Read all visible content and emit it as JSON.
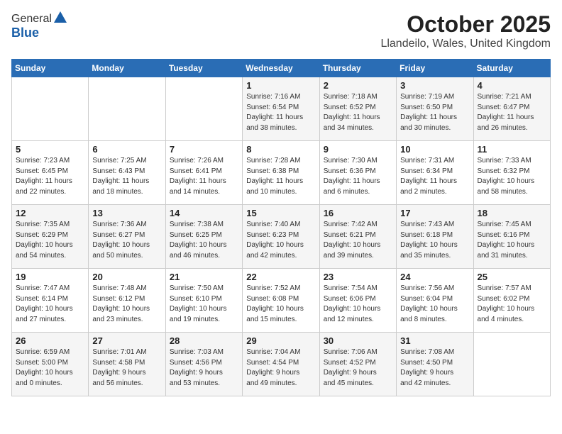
{
  "header": {
    "logo_general": "General",
    "logo_blue": "Blue",
    "month": "October 2025",
    "location": "Llandeilo, Wales, United Kingdom"
  },
  "days_of_week": [
    "Sunday",
    "Monday",
    "Tuesday",
    "Wednesday",
    "Thursday",
    "Friday",
    "Saturday"
  ],
  "weeks": [
    [
      {
        "day": "",
        "content": ""
      },
      {
        "day": "",
        "content": ""
      },
      {
        "day": "",
        "content": ""
      },
      {
        "day": "1",
        "content": "Sunrise: 7:16 AM\nSunset: 6:54 PM\nDaylight: 11 hours\nand 38 minutes."
      },
      {
        "day": "2",
        "content": "Sunrise: 7:18 AM\nSunset: 6:52 PM\nDaylight: 11 hours\nand 34 minutes."
      },
      {
        "day": "3",
        "content": "Sunrise: 7:19 AM\nSunset: 6:50 PM\nDaylight: 11 hours\nand 30 minutes."
      },
      {
        "day": "4",
        "content": "Sunrise: 7:21 AM\nSunset: 6:47 PM\nDaylight: 11 hours\nand 26 minutes."
      }
    ],
    [
      {
        "day": "5",
        "content": "Sunrise: 7:23 AM\nSunset: 6:45 PM\nDaylight: 11 hours\nand 22 minutes."
      },
      {
        "day": "6",
        "content": "Sunrise: 7:25 AM\nSunset: 6:43 PM\nDaylight: 11 hours\nand 18 minutes."
      },
      {
        "day": "7",
        "content": "Sunrise: 7:26 AM\nSunset: 6:41 PM\nDaylight: 11 hours\nand 14 minutes."
      },
      {
        "day": "8",
        "content": "Sunrise: 7:28 AM\nSunset: 6:38 PM\nDaylight: 11 hours\nand 10 minutes."
      },
      {
        "day": "9",
        "content": "Sunrise: 7:30 AM\nSunset: 6:36 PM\nDaylight: 11 hours\nand 6 minutes."
      },
      {
        "day": "10",
        "content": "Sunrise: 7:31 AM\nSunset: 6:34 PM\nDaylight: 11 hours\nand 2 minutes."
      },
      {
        "day": "11",
        "content": "Sunrise: 7:33 AM\nSunset: 6:32 PM\nDaylight: 10 hours\nand 58 minutes."
      }
    ],
    [
      {
        "day": "12",
        "content": "Sunrise: 7:35 AM\nSunset: 6:29 PM\nDaylight: 10 hours\nand 54 minutes."
      },
      {
        "day": "13",
        "content": "Sunrise: 7:36 AM\nSunset: 6:27 PM\nDaylight: 10 hours\nand 50 minutes."
      },
      {
        "day": "14",
        "content": "Sunrise: 7:38 AM\nSunset: 6:25 PM\nDaylight: 10 hours\nand 46 minutes."
      },
      {
        "day": "15",
        "content": "Sunrise: 7:40 AM\nSunset: 6:23 PM\nDaylight: 10 hours\nand 42 minutes."
      },
      {
        "day": "16",
        "content": "Sunrise: 7:42 AM\nSunset: 6:21 PM\nDaylight: 10 hours\nand 39 minutes."
      },
      {
        "day": "17",
        "content": "Sunrise: 7:43 AM\nSunset: 6:18 PM\nDaylight: 10 hours\nand 35 minutes."
      },
      {
        "day": "18",
        "content": "Sunrise: 7:45 AM\nSunset: 6:16 PM\nDaylight: 10 hours\nand 31 minutes."
      }
    ],
    [
      {
        "day": "19",
        "content": "Sunrise: 7:47 AM\nSunset: 6:14 PM\nDaylight: 10 hours\nand 27 minutes."
      },
      {
        "day": "20",
        "content": "Sunrise: 7:48 AM\nSunset: 6:12 PM\nDaylight: 10 hours\nand 23 minutes."
      },
      {
        "day": "21",
        "content": "Sunrise: 7:50 AM\nSunset: 6:10 PM\nDaylight: 10 hours\nand 19 minutes."
      },
      {
        "day": "22",
        "content": "Sunrise: 7:52 AM\nSunset: 6:08 PM\nDaylight: 10 hours\nand 15 minutes."
      },
      {
        "day": "23",
        "content": "Sunrise: 7:54 AM\nSunset: 6:06 PM\nDaylight: 10 hours\nand 12 minutes."
      },
      {
        "day": "24",
        "content": "Sunrise: 7:56 AM\nSunset: 6:04 PM\nDaylight: 10 hours\nand 8 minutes."
      },
      {
        "day": "25",
        "content": "Sunrise: 7:57 AM\nSunset: 6:02 PM\nDaylight: 10 hours\nand 4 minutes."
      }
    ],
    [
      {
        "day": "26",
        "content": "Sunrise: 6:59 AM\nSunset: 5:00 PM\nDaylight: 10 hours\nand 0 minutes."
      },
      {
        "day": "27",
        "content": "Sunrise: 7:01 AM\nSunset: 4:58 PM\nDaylight: 9 hours\nand 56 minutes."
      },
      {
        "day": "28",
        "content": "Sunrise: 7:03 AM\nSunset: 4:56 PM\nDaylight: 9 hours\nand 53 minutes."
      },
      {
        "day": "29",
        "content": "Sunrise: 7:04 AM\nSunset: 4:54 PM\nDaylight: 9 hours\nand 49 minutes."
      },
      {
        "day": "30",
        "content": "Sunrise: 7:06 AM\nSunset: 4:52 PM\nDaylight: 9 hours\nand 45 minutes."
      },
      {
        "day": "31",
        "content": "Sunrise: 7:08 AM\nSunset: 4:50 PM\nDaylight: 9 hours\nand 42 minutes."
      },
      {
        "day": "",
        "content": ""
      }
    ]
  ]
}
